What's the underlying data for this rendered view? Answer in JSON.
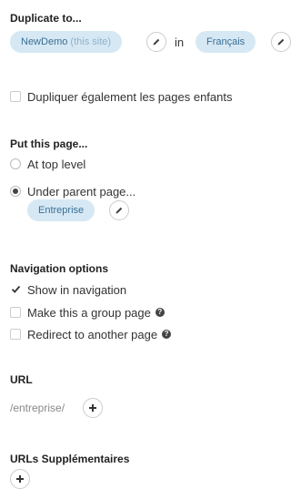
{
  "duplicate": {
    "title": "Duplicate to...",
    "site_name": "NewDemo",
    "site_suffix": "(this site)",
    "in_label": "in",
    "language": "Français"
  },
  "children_option": {
    "label": "Dupliquer également les pages enfants",
    "checked": false
  },
  "placement": {
    "title": "Put this page...",
    "options": [
      {
        "label": "At top level",
        "selected": false
      },
      {
        "label": "Under parent page...",
        "selected": true
      }
    ],
    "parent_page": "Entreprise"
  },
  "navigation": {
    "title": "Navigation options",
    "options": [
      {
        "label": "Show in navigation",
        "checked": true,
        "help": false
      },
      {
        "label": "Make this a group page",
        "checked": false,
        "help": true
      },
      {
        "label": "Redirect to another page",
        "checked": false,
        "help": true
      }
    ]
  },
  "url": {
    "title": "URL",
    "value": "/entreprise/"
  },
  "extra_urls": {
    "title": "URLs Supplémentaires"
  },
  "icons": {
    "edit": "pencil-icon",
    "add": "plus-icon",
    "check": "check-icon",
    "help": "question-circle-icon"
  },
  "colors": {
    "pill_bg": "#d6e8f4",
    "pill_text": "#3a6f95",
    "muted_text": "#888888"
  }
}
